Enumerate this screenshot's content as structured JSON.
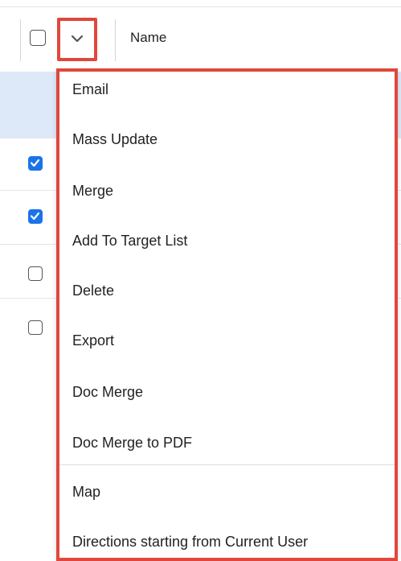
{
  "header": {
    "top_partial_text": "",
    "name_column": "Name"
  },
  "rows": [
    {
      "checked": false,
      "highlighted": true
    },
    {
      "checked": true
    },
    {
      "checked": true
    },
    {
      "checked": false
    },
    {
      "checked": false
    }
  ],
  "menu": {
    "items": [
      "Email",
      "Mass Update",
      "Merge",
      "Add To Target List",
      "Delete",
      "Export",
      "Doc Merge",
      "Doc Merge to PDF",
      "Map",
      "Directions starting from Current User"
    ]
  },
  "colors": {
    "highlight_border": "#e0473c",
    "checkbox_checked": "#1a73e8",
    "row_highlight": "#dde9f8"
  },
  "icons": {
    "chevron": "chevron-down-icon",
    "check": "check-icon"
  }
}
